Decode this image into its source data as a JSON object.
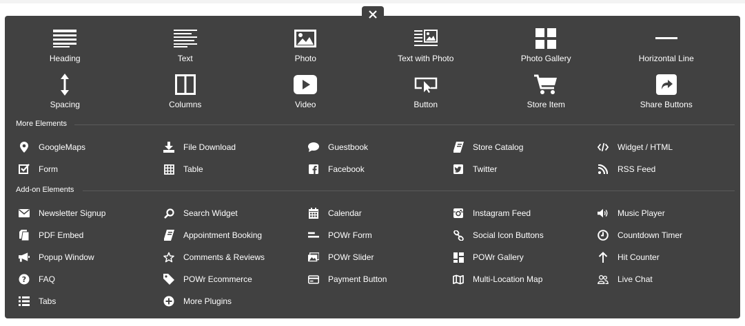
{
  "close_icon": "close-icon",
  "main_elements": [
    {
      "label": "Heading",
      "icon": "heading-icon"
    },
    {
      "label": "Text",
      "icon": "text-icon"
    },
    {
      "label": "Photo",
      "icon": "photo-icon"
    },
    {
      "label": "Text with Photo",
      "icon": "text-with-photo-icon"
    },
    {
      "label": "Photo Gallery",
      "icon": "photo-gallery-icon"
    },
    {
      "label": "Horizontal Line",
      "icon": "horizontal-line-icon"
    },
    {
      "label": "Spacing",
      "icon": "spacing-icon"
    },
    {
      "label": "Columns",
      "icon": "columns-icon"
    },
    {
      "label": "Video",
      "icon": "video-icon"
    },
    {
      "label": "Button",
      "icon": "button-icon"
    },
    {
      "label": "Store Item",
      "icon": "cart-icon"
    },
    {
      "label": "Share Buttons",
      "icon": "share-icon"
    }
  ],
  "more_elements": {
    "title": "More Elements",
    "items": [
      {
        "label": "GoogleMaps",
        "icon": "map-marker-icon"
      },
      {
        "label": "File Download",
        "icon": "download-icon"
      },
      {
        "label": "Guestbook",
        "icon": "comment-icon"
      },
      {
        "label": "Store Catalog",
        "icon": "catalog-icon"
      },
      {
        "label": "Widget / HTML",
        "icon": "code-icon"
      },
      {
        "label": "Form",
        "icon": "checkbox-icon"
      },
      {
        "label": "Table",
        "icon": "table-icon"
      },
      {
        "label": "Facebook",
        "icon": "facebook-icon"
      },
      {
        "label": "Twitter",
        "icon": "twitter-icon"
      },
      {
        "label": "RSS Feed",
        "icon": "rss-icon"
      }
    ]
  },
  "addon_elements": {
    "title": "Add-on Elements",
    "items": [
      {
        "label": "Newsletter Signup",
        "icon": "envelope-icon"
      },
      {
        "label": "Search Widget",
        "icon": "search-icon"
      },
      {
        "label": "Calendar",
        "icon": "calendar-icon"
      },
      {
        "label": "Instagram Feed",
        "icon": "instagram-icon"
      },
      {
        "label": "Music Player",
        "icon": "volume-icon"
      },
      {
        "label": "PDF Embed",
        "icon": "pdf-icon"
      },
      {
        "label": "Appointment Booking",
        "icon": "book-icon"
      },
      {
        "label": "POWr Form",
        "icon": "form-lines-icon"
      },
      {
        "label": "Social Icon Buttons",
        "icon": "link-icon"
      },
      {
        "label": "Countdown Timer",
        "icon": "clock-icon"
      },
      {
        "label": "Popup Window",
        "icon": "megaphone-icon"
      },
      {
        "label": "Comments & Reviews",
        "icon": "star-icon"
      },
      {
        "label": "POWr Slider",
        "icon": "slider-icon"
      },
      {
        "label": "POWr Gallery",
        "icon": "gallery-grid-icon"
      },
      {
        "label": "Hit Counter",
        "icon": "arrow-up-icon"
      },
      {
        "label": "FAQ",
        "icon": "question-icon"
      },
      {
        "label": "POWr Ecommerce",
        "icon": "tag-icon"
      },
      {
        "label": "Payment Button",
        "icon": "credit-card-icon"
      },
      {
        "label": "Multi-Location Map",
        "icon": "map-icon"
      },
      {
        "label": "Live Chat",
        "icon": "users-icon"
      },
      {
        "label": "Tabs",
        "icon": "list-icon"
      },
      {
        "label": "More Plugins",
        "icon": "plus-circle-icon"
      }
    ]
  }
}
